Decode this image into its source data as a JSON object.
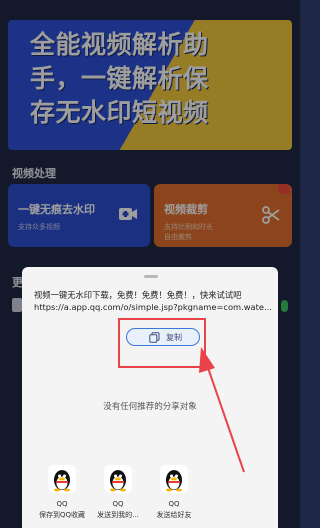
{
  "banner": {
    "lines": [
      "全能视频解析助",
      "手，一键解析保",
      "存无水印短视频"
    ]
  },
  "sections": {
    "video_processing": "视频处理",
    "more_peek": "更"
  },
  "cards": [
    {
      "title": "一键无痕去水印",
      "subtitle": "支持众多视频"
    },
    {
      "title": "视频裁剪",
      "subtitle": "支持比例和时长\n自由裁剪"
    }
  ],
  "share_sheet": {
    "text_line1": "视频一键无水印下载，免费！免费！免费！，快来试试吧",
    "text_line2": "https://a.app.qq.com/o/simple.jsp?pkgname=com.wate...",
    "copy_label": "复制",
    "no_recommend": "没有任何推荐的分享对象",
    "targets": [
      {
        "name": "QQ",
        "label": "保存到QQ收藏",
        "icon": "qq-penguin-icon"
      },
      {
        "name": "QQ",
        "label": "发送到我的...",
        "icon": "qq-penguin-icon"
      },
      {
        "name": "QQ",
        "label": "发送给好友",
        "icon": "qq-penguin-icon"
      }
    ]
  },
  "colors": {
    "accent_red": "#e94248",
    "banner_blue": "#2c51d9",
    "banner_yellow": "#f2c93a",
    "card_blue": "#2c4ed1",
    "card_orange": "#e06f2c"
  }
}
